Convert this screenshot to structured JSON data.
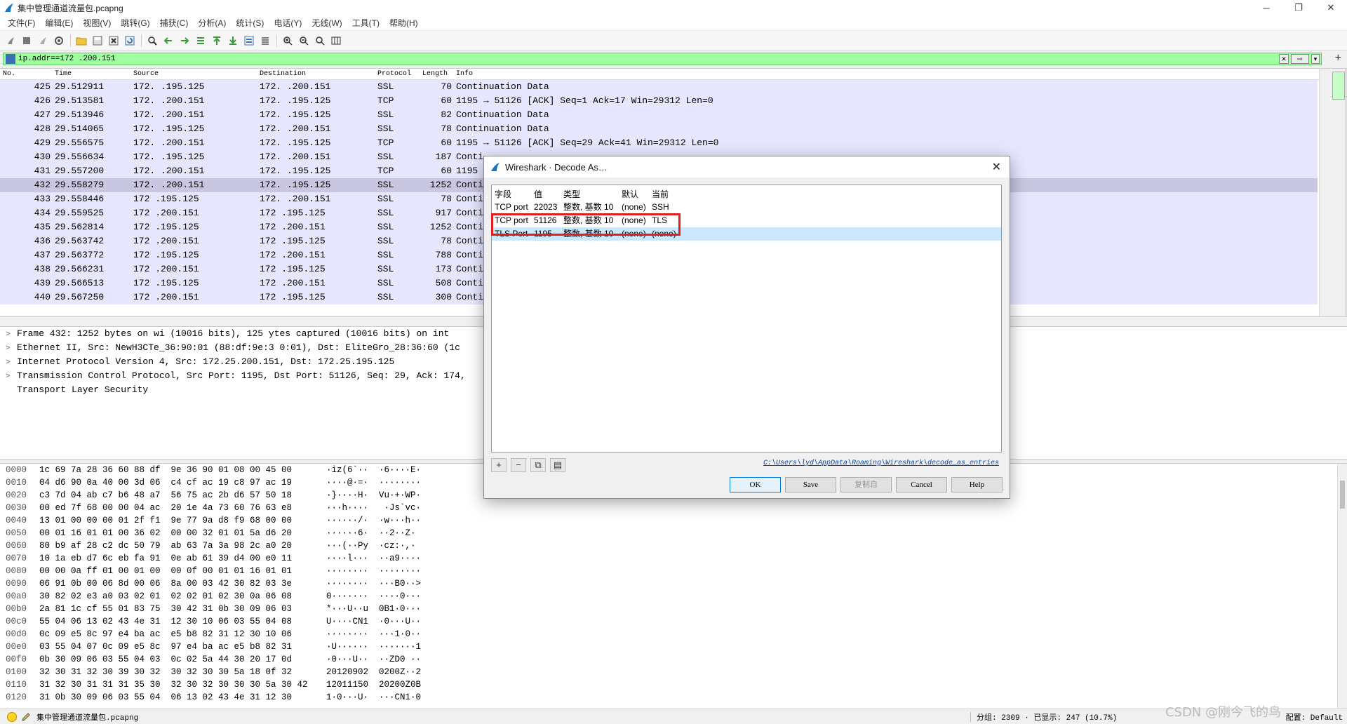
{
  "window": {
    "title": "集中管理通道流量包.pcapng",
    "minimize": "─",
    "restore": "❐",
    "close": "✕"
  },
  "menu": [
    "文件(F)",
    "编辑(E)",
    "视图(V)",
    "跳转(G)",
    "捕获(C)",
    "分析(A)",
    "统计(S)",
    "电话(Y)",
    "无线(W)",
    "工具(T)",
    "帮助(H)"
  ],
  "filter": {
    "text": "ip.addr==172     .200.151",
    "arrow": "⇨"
  },
  "packet_list": {
    "headers": {
      "no": "No.",
      "time": "Time",
      "source": "Source",
      "destination": "Destination",
      "protocol": "Protocol",
      "length": "Length",
      "info": "Info"
    },
    "rows": [
      {
        "no": "425",
        "time": "29.512911",
        "src": "172.   .195.125",
        "dst": "172.   .200.151",
        "proto": "SSL",
        "len": "70",
        "info": "Continuation Data"
      },
      {
        "no": "426",
        "time": "29.513581",
        "src": "172.   .200.151",
        "dst": "172.   .195.125",
        "proto": "TCP",
        "len": "60",
        "info": "1195 → 51126 [ACK] Seq=1 Ack=17 Win=29312 Len=0"
      },
      {
        "no": "427",
        "time": "29.513946",
        "src": "172.   .200.151",
        "dst": "172.   .195.125",
        "proto": "SSL",
        "len": "82",
        "info": "Continuation Data"
      },
      {
        "no": "428",
        "time": "29.514065",
        "src": "172.   .195.125",
        "dst": "172.   .200.151",
        "proto": "SSL",
        "len": "78",
        "info": "Continuation Data"
      },
      {
        "no": "429",
        "time": "29.556575",
        "src": "172.   .200.151",
        "dst": "172.   .195.125",
        "proto": "TCP",
        "len": "60",
        "info": "1195 → 51126 [ACK] Seq=29 Ack=41 Win=29312 Len=0"
      },
      {
        "no": "430",
        "time": "29.556634",
        "src": "172.   .195.125",
        "dst": "172.   .200.151",
        "proto": "SSL",
        "len": "187",
        "info": "Conti"
      },
      {
        "no": "431",
        "time": "29.557200",
        "src": "172.   .200.151",
        "dst": "172.   .195.125",
        "proto": "TCP",
        "len": "60",
        "info": "1195"
      },
      {
        "no": "432",
        "time": "29.558279",
        "src": "172.   .200.151",
        "dst": "172.   .195.125",
        "proto": "SSL",
        "len": "1252",
        "info": "Conti"
      },
      {
        "no": "433",
        "time": "29.558446",
        "src": "172   .195.125",
        "dst": "172.   .200.151",
        "proto": "SSL",
        "len": "78",
        "info": "Conti"
      },
      {
        "no": "434",
        "time": "29.559525",
        "src": "172   .200.151",
        "dst": "172   .195.125",
        "proto": "SSL",
        "len": "917",
        "info": "Conti"
      },
      {
        "no": "435",
        "time": "29.562814",
        "src": "172   .195.125",
        "dst": "172   .200.151",
        "proto": "SSL",
        "len": "1252",
        "info": "Conti"
      },
      {
        "no": "436",
        "time": "29.563742",
        "src": "172   .200.151",
        "dst": "172   .195.125",
        "proto": "SSL",
        "len": "78",
        "info": "Conti"
      },
      {
        "no": "437",
        "time": "29.563772",
        "src": "172   .195.125",
        "dst": "172   .200.151",
        "proto": "SSL",
        "len": "788",
        "info": "Conti"
      },
      {
        "no": "438",
        "time": "29.566231",
        "src": "172   .200.151",
        "dst": "172   .195.125",
        "proto": "SSL",
        "len": "173",
        "info": "Conti"
      },
      {
        "no": "439",
        "time": "29.566513",
        "src": "172   .195.125",
        "dst": "172   .200.151",
        "proto": "SSL",
        "len": "508",
        "info": "Conti"
      },
      {
        "no": "440",
        "time": "29.567250",
        "src": "172   .200.151",
        "dst": "172   .195.125",
        "proto": "SSL",
        "len": "300",
        "info": "Conti"
      }
    ],
    "selected_no": "432"
  },
  "details": [
    {
      "arrow": ">",
      "text": "Frame 432: 1252 bytes on wi    (10016 bits), 125   ytes captured (10016 bits) on int"
    },
    {
      "arrow": ">",
      "text": "Ethernet II, Src: NewH3CTe_36:90:01 (88:df:9e:3   0:01), Dst: EliteGro_28:36:60 (1c"
    },
    {
      "arrow": ">",
      "text": "Internet Protocol Version 4, Src: 172.25.200.151, Dst: 172.25.195.125"
    },
    {
      "arrow": ">",
      "text": "Transmission Control Protocol, Src Port: 1195, Dst Port: 51126, Seq: 29, Ack: 174,"
    },
    {
      "arrow": "",
      "text": "Transport Layer Security"
    }
  ],
  "bytes": [
    {
      "off": "0000",
      "hex": "1c 69 7a 28 36 60 88 df  9e 36 90 01 08 00 45 00",
      "ascii": "·iz(6`··  ·6····E·"
    },
    {
      "off": "0010",
      "hex": "04 d6 90 0a 40 00 3d 06  c4 cf ac 19 c8 97 ac 19",
      "ascii": "····@·=·  ········"
    },
    {
      "off": "0020",
      "hex": "c3 7d 04 ab c7 b6 48 a7  56 75 ac 2b d6 57 50 18",
      "ascii": "·}····H·  Vu·+·WP·"
    },
    {
      "off": "0030",
      "hex": "00 ed 7f 68 00 00 04 ac  20 1e 4a 73 60 76 63 e8",
      "ascii": "···h····   ·Js`vc·"
    },
    {
      "off": "0040",
      "hex": "13 01 00 00 00 01 2f f1  9e 77 9a d8 f9 68 00 00",
      "ascii": "······/·  ·w···h··"
    },
    {
      "off": "0050",
      "hex": "00 01 16 01 01 00 36 02  00 00 32 01 01 5a d6 20",
      "ascii": "······6·  ··2··Z· "
    },
    {
      "off": "0060",
      "hex": "80 b9 af 28 c2 dc 50 79  ab 63 7a 3a 98 2c a0 20",
      "ascii": "···(··Py  ·cz:·,· "
    },
    {
      "off": "0070",
      "hex": "10 1a eb d7 6c eb fa 91  0e ab 61 39 d4 00 e0 11",
      "ascii": "····l···  ··a9····"
    },
    {
      "off": "0080",
      "hex": "00 00 0a ff 01 00 01 00  00 0f 00 01 01 16 01 01",
      "ascii": "········  ········"
    },
    {
      "off": "0090",
      "hex": "06 91 0b 00 06 8d 00 06  8a 00 03 42 30 82 03 3e",
      "ascii": "········  ···B0··>"
    },
    {
      "off": "00a0",
      "hex": "30 82 02 e3 a0 03 02 01  02 02 01 02 30 0a 06 08",
      "ascii": "0·······  ····0···"
    },
    {
      "off": "00b0",
      "hex": "2a 81 1c cf 55 01 83 75  30 42 31 0b 30 09 06 03",
      "ascii": "*···U··u  0B1·0···"
    },
    {
      "off": "00c0",
      "hex": "55 04 06 13 02 43 4e 31  12 30 10 06 03 55 04 08",
      "ascii": "U····CN1  ·0···U··"
    },
    {
      "off": "00d0",
      "hex": "0c 09 e5 8c 97 e4 ba ac  e5 b8 82 31 12 30 10 06",
      "ascii": "········  ···1·0··"
    },
    {
      "off": "00e0",
      "hex": "03 55 04 07 0c 09 e5 8c  97 e4 ba ac e5 b8 82 31",
      "ascii": "·U······  ·······1"
    },
    {
      "off": "00f0",
      "hex": "0b 30 09 06 03 55 04 03  0c 02 5a 44 30 20 17 0d",
      "ascii": "·0···U··  ··ZD0 ··"
    },
    {
      "off": "0100",
      "hex": "32 30 31 32 30 39 30 32  30 32 30 30 5a 18 0f 32",
      "ascii": "20120902  0200Z··2"
    },
    {
      "off": "0110",
      "hex": "31 32 30 31 31 31 35 30  32 30 32 30 30 30 5a 30 42",
      "ascii": "12011150  20200Z0B"
    },
    {
      "off": "0120",
      "hex": "31 0b 30 09 06 03 55 04  06 13 02 43 4e 31 12 30",
      "ascii": "1·0···U·  ···CN1·0"
    }
  ],
  "status": {
    "file": "集中管理通道流量包.pcapng",
    "stats": "分组: 2309 · 已显示: 247 (10.7%)",
    "profile": "配置: Default",
    "watermark": "CSDN @刚今飞的鸟"
  },
  "dialog": {
    "title": "Wireshark · Decode As…",
    "close": "✕",
    "headers": {
      "field": "字段",
      "value": "值",
      "type": "类型",
      "default": "默认",
      "current": "当前"
    },
    "rows": [
      {
        "field": "TCP port",
        "value": "22023",
        "type": "整数, 基数 10",
        "default": "(none)",
        "current": "SSH"
      },
      {
        "field": "TCP port",
        "value": "51126",
        "type": "整数, 基数 10",
        "default": "(none)",
        "current": "TLS"
      },
      {
        "field": "TLS Port",
        "value": "1195",
        "type": "整数, 基数 10",
        "default": "(none)",
        "current": "(none)"
      }
    ],
    "tools": [
      "+",
      "−",
      "⧉",
      "▤"
    ],
    "path_link": "C:\\Users\\lyd\\AppData\\Roaming\\Wireshark\\decode_as_entries",
    "buttons": {
      "ok": "OK",
      "save": "Save",
      "copy_from": "复制自",
      "cancel": "Cancel",
      "help": "Help"
    }
  }
}
